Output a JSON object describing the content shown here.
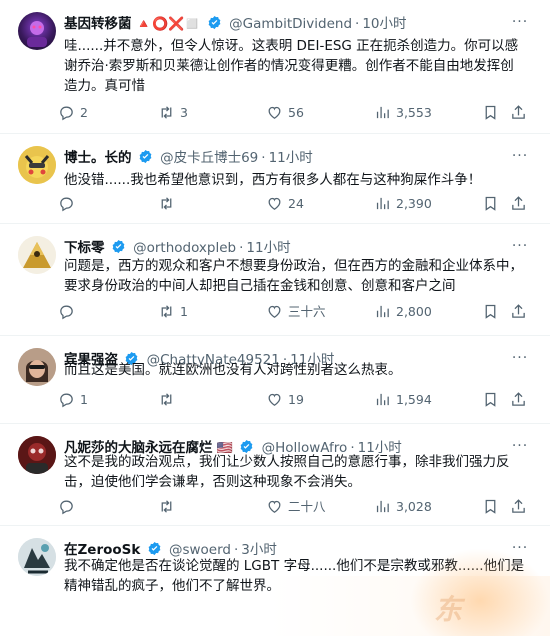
{
  "tweets": [
    {
      "name": "基因转移菌",
      "name_suffix": "🔺⭕❌◻️",
      "handle": "@GambitDividend",
      "time": "10小时",
      "text": "哇......并不意外，但令人惊讶。这表明 DEI-ESG 正在扼杀创造力。你可以感谢乔治·索罗斯和贝莱德让创作者的情况变得更糟。创作者不能自由地发挥创造力。真可惜",
      "replies": "2",
      "retweets": "3",
      "likes": "56",
      "views": "3,553"
    },
    {
      "name": "博士。长的",
      "name_suffix": "",
      "handle": "@皮卡丘博士69",
      "time": "11小时",
      "text": "他没错......我也希望他意识到，西方有很多人都在与这种狗屎作斗争！",
      "replies": "",
      "retweets": "",
      "likes": "24",
      "views": "2,390"
    },
    {
      "name": "下标零",
      "name_suffix": "",
      "handle": "@orthodoxpleb",
      "time": "11小时",
      "text": "问题是，西方的观众和客户不想要身份政治，但在西方的金融和企业体系中，要求身份政治的中间人却把自己插在金钱和创意、创意和客户之间",
      "replies": "",
      "retweets": "1",
      "likes": "三十六",
      "views": "2,800"
    },
    {
      "name": "宾果强盗",
      "name_suffix": "",
      "handle": "@ChattyNate49521",
      "time": "11小时",
      "text": "而且这是美国。就连欧洲也没有人对跨性别者这么热衷。",
      "replies": "1",
      "retweets": "",
      "likes": "19",
      "views": "1,594"
    },
    {
      "name": "凡妮莎的大脑永远在腐烂",
      "name_suffix": "🇺🇸",
      "handle": "@HollowAfro",
      "time": "11小时",
      "text": "这不是我的政治观点，我们让少数人按照自己的意愿行事，除非我们强力反击，迫使他们学会谦卑，否则这种现象不会消失。",
      "replies": "",
      "retweets": "",
      "likes": "二十八",
      "views": "3,028"
    },
    {
      "name": "在ZerooSk",
      "name_suffix": "",
      "handle": "@swoerd",
      "time": "3小时",
      "text": "我不确定他是否在谈论觉醒的 LGBT 字母......他们不是宗教或邪教......他们是精神错乱的疯子，他们不了解世界。",
      "replies": "",
      "retweets": "",
      "likes": "",
      "views": ""
    }
  ],
  "watermark": "东",
  "colors": {
    "verified": "#1d9bf0",
    "secondary_text": "#536471",
    "primary_text": "#0f1419",
    "divider": "#eff3f4"
  },
  "icons": [
    "reply-icon",
    "retweet-icon",
    "like-icon",
    "views-icon",
    "bookmark-icon",
    "share-icon",
    "more-icon",
    "verified-badge-icon"
  ]
}
